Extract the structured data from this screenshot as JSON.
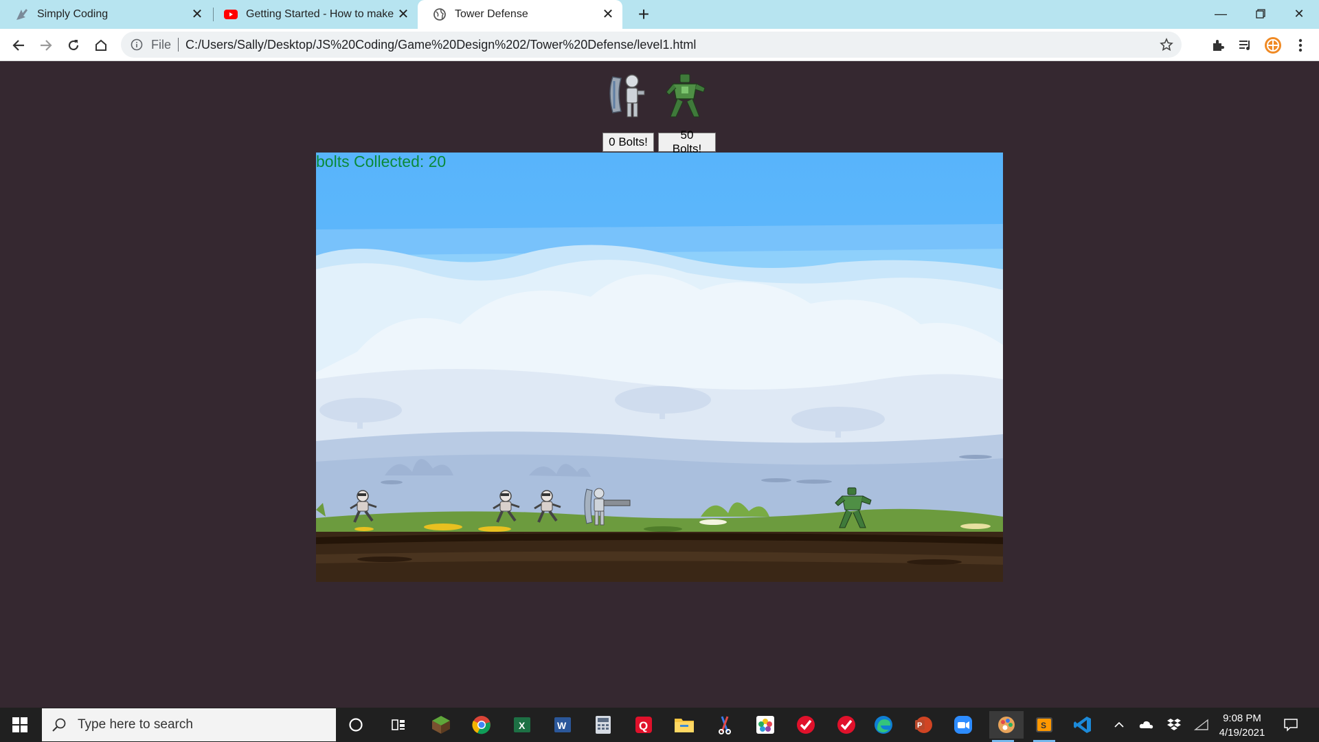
{
  "browser": {
    "tabs": [
      {
        "title": "Simply Coding",
        "icon": "simply-coding-icon"
      },
      {
        "title": "Getting Started - How to make A",
        "icon": "youtube-icon"
      },
      {
        "title": "Tower Defense",
        "icon": "globe-icon"
      }
    ],
    "active_tab": 2,
    "address": {
      "scheme": "File",
      "url": "C:/Users/Sally/Desktop/JS%20Coding/Game%20Design%202/Tower%20Defense/level1.html"
    }
  },
  "game": {
    "units": [
      {
        "name": "shield-knight",
        "icon": "shield-knight-icon"
      },
      {
        "name": "green-robot",
        "icon": "green-robot-icon"
      }
    ],
    "buttons": [
      "0 Bolts!",
      "50 Bolts!"
    ],
    "score_text": "bolts Collected: 20",
    "colors": {
      "sky": "#5ab5fb",
      "score": "#0a8a3a",
      "grass": "#6a9a3b",
      "dirt": "#3e2a1a"
    }
  },
  "taskbar": {
    "search_placeholder": "Type here to search",
    "apps": [
      "cortana-icon",
      "task-view-icon",
      "minecraft-icon",
      "chrome-icon",
      "excel-icon",
      "word-icon",
      "calculator-icon",
      "q-app-icon",
      "file-explorer-icon",
      "snipping-icon",
      "photos-icon",
      "todo-icon",
      "todo-icon-2",
      "edge-icon",
      "powerpoint-icon",
      "zoom-icon",
      "paint-icon",
      "sublime-icon",
      "vscode-icon"
    ],
    "time": "9:08 PM",
    "date": "4/19/2021"
  }
}
